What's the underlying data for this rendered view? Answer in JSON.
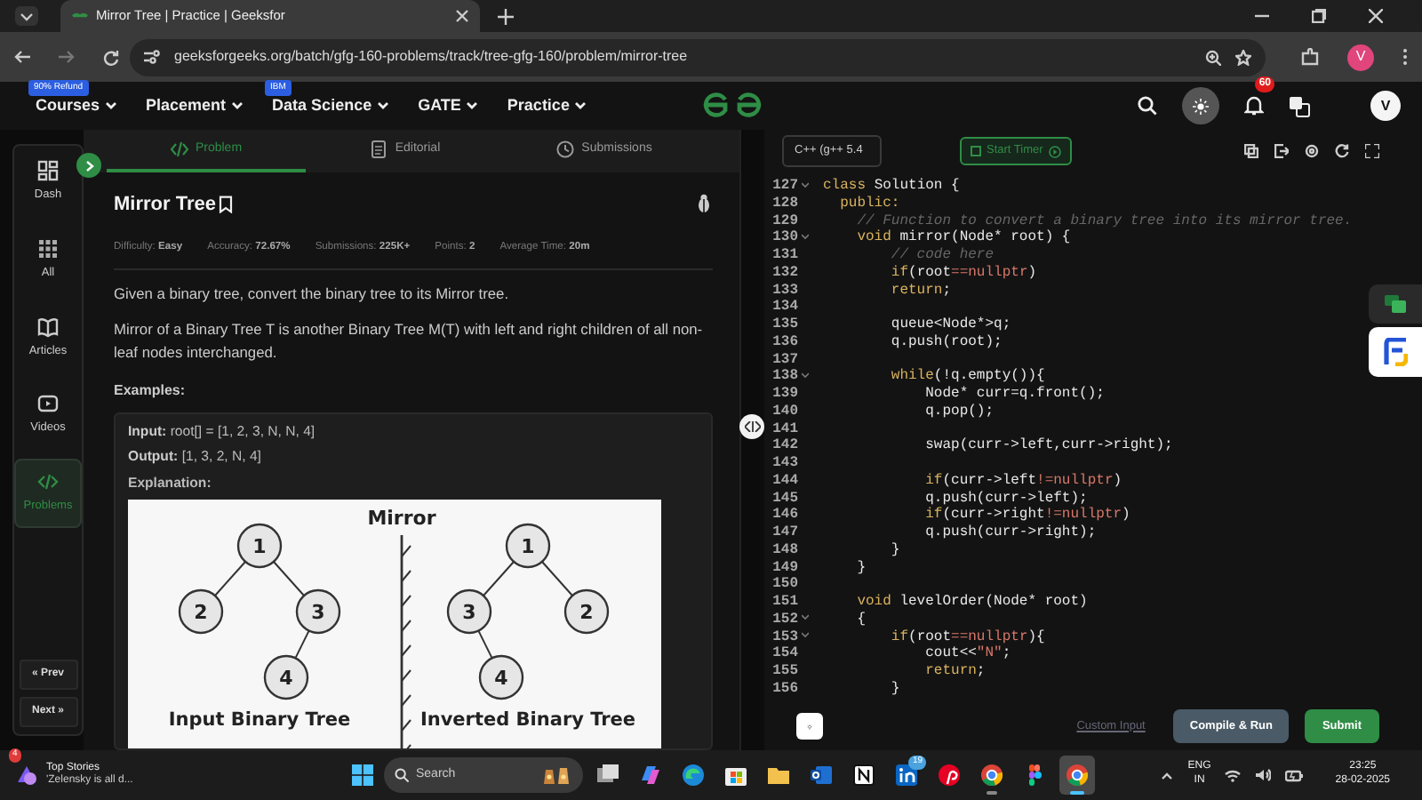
{
  "browser": {
    "tab_title": "Mirror Tree | Practice | Geeksfor",
    "url": "geeksforgeeks.org/batch/gfg-160-problems/track/tree-gfg-160/problem/mirror-tree",
    "avatar": "V"
  },
  "site_nav": {
    "items": [
      {
        "label": "Courses",
        "badge": "90% Refund"
      },
      {
        "label": "Placement"
      },
      {
        "label": "Data Science",
        "badge": "IBM"
      },
      {
        "label": "GATE"
      },
      {
        "label": "Practice"
      }
    ],
    "notifications": "60",
    "avatar": "V"
  },
  "sidebar": {
    "items": [
      {
        "label": "Dash",
        "selected": false
      },
      {
        "label": "All",
        "selected": false
      },
      {
        "label": "Articles",
        "selected": false
      },
      {
        "label": "Videos",
        "selected": false
      },
      {
        "label": "Problems",
        "selected": true
      }
    ],
    "prev": "« Prev",
    "next": "Next »"
  },
  "problem": {
    "tabs": [
      {
        "label": "Problem",
        "selected": true
      },
      {
        "label": "Editorial",
        "selected": false
      },
      {
        "label": "Submissions",
        "selected": false
      }
    ],
    "title": "Mirror Tree",
    "stats": [
      "Difficulty: **Easy**",
      "Accuracy: **72.67%**",
      "Submissions: **225K+**",
      "Points: **2**",
      "Average Time: **20m**"
    ],
    "paragraphs": [
      "Given a binary tree, convert the binary tree to its Mirror tree.",
      "Mirror of a Binary Tree T is another Binary Tree M(T) with left and right children of all non-leaf nodes interchanged."
    ],
    "examples_heading": "Examples:",
    "example": {
      "lines": [
        "**Input:** root[] = [1, 2, 3, N, N, 4]",
        "**Output:** [1, 3, 2, N, 4]"
      ],
      "explanation": "Explanation:",
      "diagram": {
        "title": "Mirror",
        "trees": [
          {
            "caption": "Input Binary Tree",
            "root": {
              "label": "1",
              "children": [
                {
                  "label": "2",
                  "kind": "left"
                },
                {
                  "label": "3",
                  "kind": "right",
                  "children": [
                    {
                      "label": "4",
                      "kind": "left"
                    }
                  ]
                }
              ]
            }
          },
          {
            "caption": "Inverted Binary Tree",
            "root": {
              "label": "1",
              "children": [
                {
                  "label": "3",
                  "kind": "left",
                  "children": [
                    {
                      "label": "4",
                      "kind": "right"
                    }
                  ]
                },
                {
                  "label": "2",
                  "kind": "right"
                }
              ]
            }
          }
        ]
      }
    }
  },
  "editor": {
    "language": "C++ (g++ 5.4",
    "timer": "Start Timer",
    "lines": [
      {
        "number": "127",
        "fold": true,
        "segments": [
          {
            "kind": "keyword",
            "text": "class"
          },
          {
            "kind": "plain",
            "text": " Solution {"
          }
        ]
      },
      {
        "number": "128",
        "fold": false,
        "segments": [
          {
            "kind": "keyword",
            "text": "  public:"
          }
        ]
      },
      {
        "number": "129",
        "fold": false,
        "segments": [
          {
            "kind": "comment",
            "text": "    // Function to convert a binary tree into its mirror tree."
          }
        ]
      },
      {
        "number": "130",
        "fold": true,
        "segments": [
          {
            "kind": "keyword",
            "text": "    void"
          },
          {
            "kind": "plain",
            "text": " mirror(Node* root) {"
          }
        ]
      },
      {
        "number": "131",
        "fold": false,
        "segments": [
          {
            "kind": "comment",
            "text": "        // code here"
          }
        ]
      },
      {
        "number": "132",
        "fold": false,
        "segments": [
          {
            "kind": "keyword",
            "text": "        if"
          },
          {
            "kind": "plain",
            "text": "(root"
          },
          {
            "kind": "literal",
            "text": "==nullptr"
          },
          {
            "kind": "plain",
            "text": ")"
          }
        ]
      },
      {
        "number": "133",
        "fold": false,
        "segments": [
          {
            "kind": "keyword",
            "text": "        return"
          },
          {
            "kind": "plain",
            "text": ";"
          }
        ]
      },
      {
        "number": "134",
        "fold": false
      },
      {
        "number": "135",
        "fold": false,
        "segments": [
          {
            "kind": "plain",
            "text": "        queue<Node*>q;"
          }
        ]
      },
      {
        "number": "136",
        "fold": false,
        "segments": [
          {
            "kind": "plain",
            "text": "        q.push(root);"
          }
        ]
      },
      {
        "number": "137",
        "fold": false
      },
      {
        "number": "138",
        "fold": true,
        "segments": [
          {
            "kind": "keyword",
            "text": "        while"
          },
          {
            "kind": "plain",
            "text": "(!q.empty()){"
          }
        ]
      },
      {
        "number": "139",
        "fold": false,
        "segments": [
          {
            "kind": "plain",
            "text": "            Node* curr=q.front();"
          }
        ]
      },
      {
        "number": "140",
        "fold": false,
        "segments": [
          {
            "kind": "plain",
            "text": "            q.pop();"
          }
        ]
      },
      {
        "number": "141",
        "fold": false
      },
      {
        "number": "142",
        "fold": false,
        "segments": [
          {
            "kind": "plain",
            "text": "            swap(curr->left,curr->right);"
          }
        ]
      },
      {
        "number": "143",
        "fold": false
      },
      {
        "number": "144",
        "fold": false,
        "segments": [
          {
            "kind": "keyword",
            "text": "            if"
          },
          {
            "kind": "plain",
            "text": "(curr->left"
          },
          {
            "kind": "literal",
            "text": "!=nullptr"
          },
          {
            "kind": "plain",
            "text": ")"
          }
        ]
      },
      {
        "number": "145",
        "fold": false,
        "segments": [
          {
            "kind": "plain",
            "text": "            q.push(curr->left);"
          }
        ]
      },
      {
        "number": "146",
        "fold": false,
        "segments": [
          {
            "kind": "keyword",
            "text": "            if"
          },
          {
            "kind": "plain",
            "text": "(curr->right"
          },
          {
            "kind": "literal",
            "text": "!=nullptr"
          },
          {
            "kind": "plain",
            "text": ")"
          }
        ]
      },
      {
        "number": "147",
        "fold": false,
        "segments": [
          {
            "kind": "plain",
            "text": "            q.push(curr->right);"
          }
        ]
      },
      {
        "number": "148",
        "fold": false,
        "segments": [
          {
            "kind": "plain",
            "text": "        }"
          }
        ]
      },
      {
        "number": "149",
        "fold": false,
        "segments": [
          {
            "kind": "plain",
            "text": "    }"
          }
        ]
      },
      {
        "number": "150",
        "fold": false
      },
      {
        "number": "151",
        "fold": false,
        "segments": [
          {
            "kind": "keyword",
            "text": "    void"
          },
          {
            "kind": "plain",
            "text": " levelOrder(Node* root)"
          }
        ]
      },
      {
        "number": "152",
        "fold": true,
        "segments": [
          {
            "kind": "plain",
            "text": "    {"
          }
        ]
      },
      {
        "number": "153",
        "fold": true,
        "segments": [
          {
            "kind": "keyword",
            "text": "        if"
          },
          {
            "kind": "plain",
            "text": "(root"
          },
          {
            "kind": "literal",
            "text": "==nullptr"
          },
          {
            "kind": "plain",
            "text": "){"
          }
        ]
      },
      {
        "number": "154",
        "fold": false,
        "segments": [
          {
            "kind": "plain",
            "text": "            cout<<"
          },
          {
            "kind": "literal",
            "text": "\"N\""
          },
          {
            "kind": "plain",
            "text": ";"
          }
        ]
      },
      {
        "number": "155",
        "fold": false,
        "segments": [
          {
            "kind": "keyword",
            "text": "            return"
          },
          {
            "kind": "plain",
            "text": ";"
          }
        ]
      },
      {
        "number": "156",
        "fold": false,
        "segments": [
          {
            "kind": "plain",
            "text": "        }"
          }
        ]
      }
    ],
    "custom_input": "Custom Input",
    "run": "Compile & Run",
    "submit": "Submit"
  },
  "taskbar": {
    "widget": {
      "badge": "4",
      "title": "Top Stories",
      "headline": "'Zelensky is all d..."
    },
    "search": {
      "placeholder": "Search"
    },
    "apps": [
      {
        "active": false,
        "running": false
      },
      {
        "active": false,
        "running": false
      },
      {
        "active": false,
        "running": false
      },
      {
        "active": false,
        "running": false
      },
      {
        "active": false,
        "running": false
      },
      {
        "active": false,
        "running": false
      },
      {
        "active": false,
        "running": false
      },
      {
        "active": false,
        "running": false,
        "badge": "19"
      },
      {
        "active": false,
        "running": false
      },
      {
        "active": false,
        "running": true
      },
      {
        "active": false,
        "running": false
      },
      {
        "active": true,
        "running": true
      }
    ],
    "tray": {
      "language": "ENG",
      "region": "IN",
      "time": "23:25",
      "date": "28-02-2025"
    }
  }
}
